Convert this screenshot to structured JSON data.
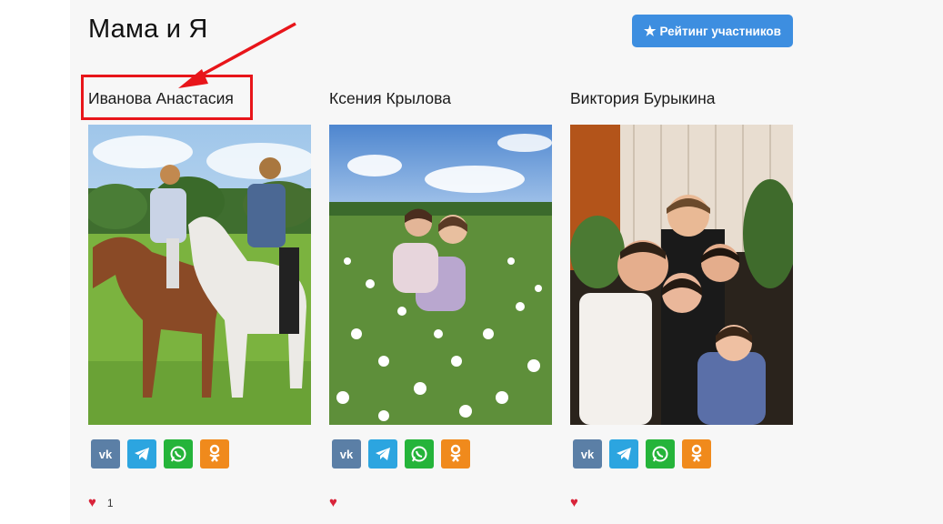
{
  "page": {
    "title": "Мама и Я",
    "rating_button_label": "Рейтинг участников",
    "rating_button_icon": "star-icon"
  },
  "colors": {
    "accent": "#3d8ee0",
    "highlight": "#e8151a",
    "heart": "#d9243a",
    "vk": "#5b7fa6",
    "telegram": "#2ca5e0",
    "whatsapp": "#25b43a",
    "odnoklassniki": "#f08a1c"
  },
  "cards": [
    {
      "name": "Иванова Анастасия",
      "likes": "1",
      "photo": "mother and daughter riding horses in a field"
    },
    {
      "name": "Ксения Крылова",
      "likes": "",
      "photo": "mother and daughter hugging in a chamomile field"
    },
    {
      "name": "Виктория Бурыкина",
      "likes": "",
      "photo": "mother with four children posing together indoors"
    }
  ],
  "share_icons": [
    "vk-icon",
    "telegram-icon",
    "whatsapp-icon",
    "odnoklassniki-icon"
  ],
  "like_icon": "heart-icon"
}
